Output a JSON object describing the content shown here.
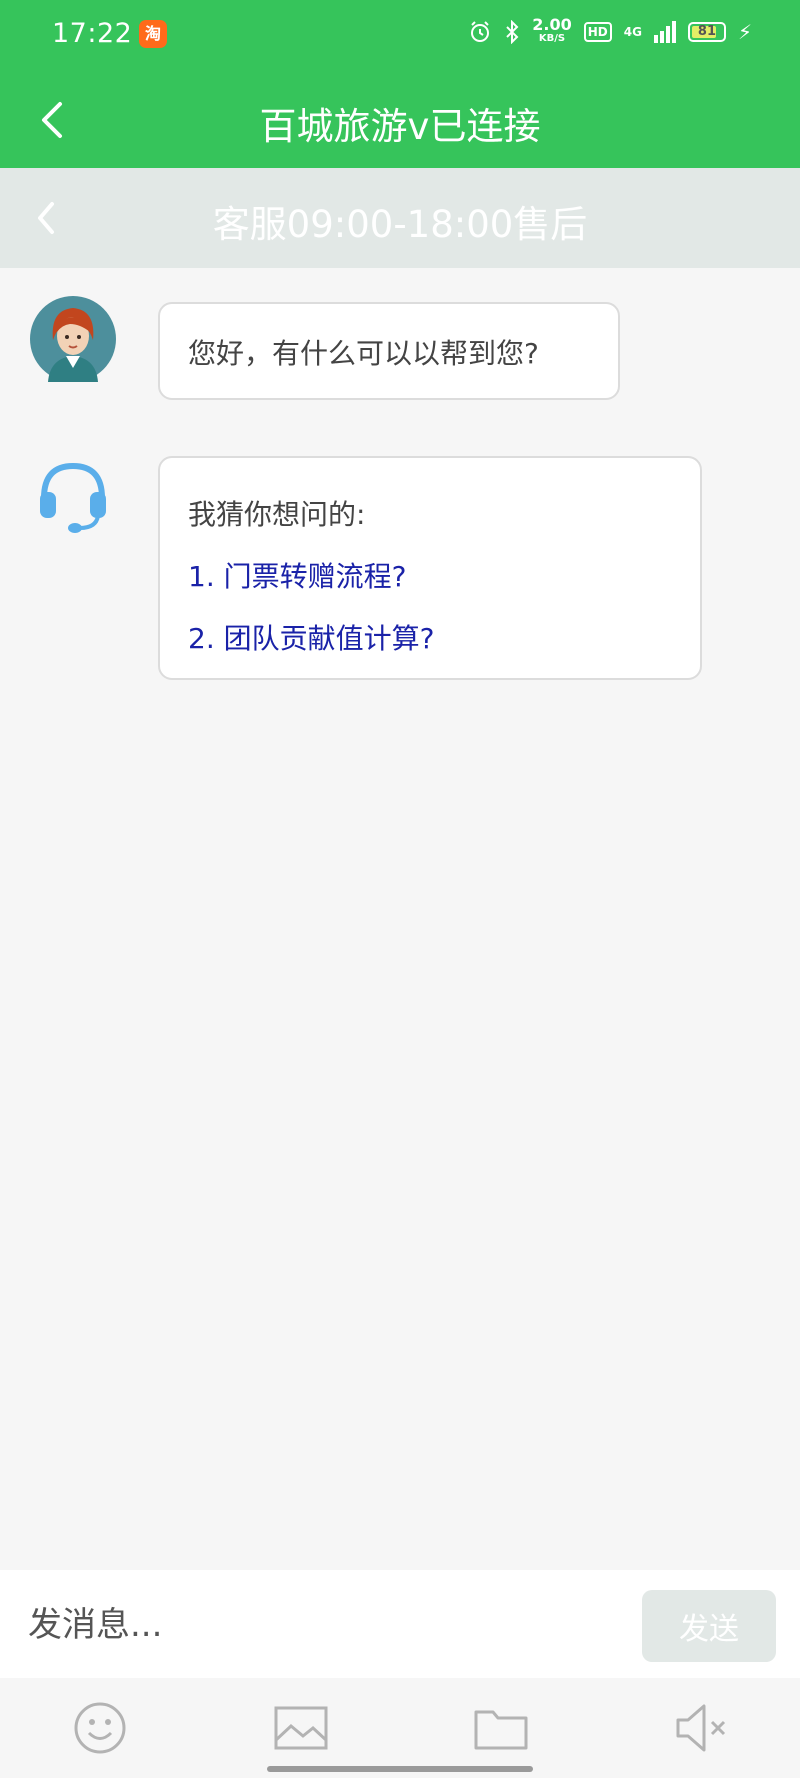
{
  "status_bar": {
    "time": "17:22",
    "app_badge": "淘",
    "speed_value": "2.00",
    "speed_unit": "KB/S",
    "hd_label": "HD",
    "network": "4G",
    "battery_level": "81",
    "battery_percent": 81
  },
  "header": {
    "title": "百城旅游v已连接"
  },
  "subheader": {
    "title": "客服09:00-18:00售后"
  },
  "messages": [
    {
      "sender_icon": "agent-avatar-icon",
      "text": "您好，有什么可以以帮到您?"
    },
    {
      "sender_icon": "headset-icon",
      "intro": "我猜你想问的:",
      "links": [
        "1. 门票转赠流程?",
        "2. 团队贡献值计算?"
      ]
    }
  ],
  "composer": {
    "placeholder": "发消息...",
    "send_label": "发送"
  },
  "toolbar": {
    "items": [
      "emoji-icon",
      "image-icon",
      "folder-icon",
      "sound-muted-icon"
    ]
  },
  "colors": {
    "header_green": "#36c45b",
    "subheader_gray": "#e2e8e6",
    "link_blue": "#1a22a8"
  }
}
